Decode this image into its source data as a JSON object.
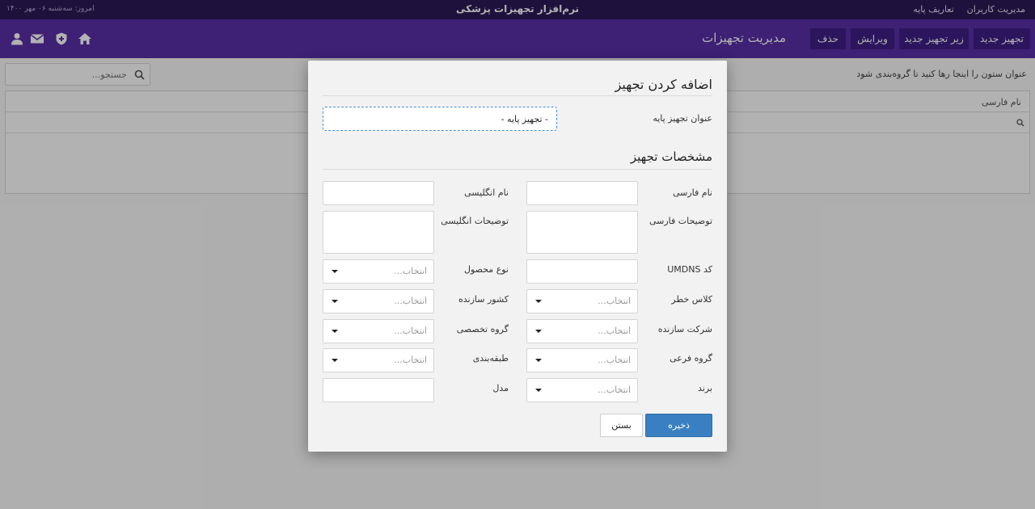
{
  "topbar": {
    "menu": [
      "مدیریت کاربران",
      "تعاریف پایه"
    ],
    "app_title": "نرم‌افزار تجهیزات پزشکی",
    "today": "امروز: سه‌شنبه ۰۶ مهر ۱۴۰۰"
  },
  "header": {
    "buttons": [
      "تجهیز جدید",
      "زیر تجهیز جدید",
      "ویرایش",
      "حذف"
    ],
    "page_title": "مدیریت تجهیزات",
    "icons": [
      "home-icon",
      "shield-icon",
      "mail-icon",
      "user-icon"
    ],
    "accent_color": "#5a2ea6",
    "top_color": "#2c1b58"
  },
  "grid": {
    "search_placeholder": "جستجو...",
    "group_hint": "عنوان ستون را اینجا رها کنید تا گروه‌بندی شود",
    "column": "نام فارسی"
  },
  "modal": {
    "title": "اضافه کردن تجهیز",
    "base_label": "عنوان تجهیز پایه",
    "base_value": "- تجهیز پایه -",
    "section_title": "مشخصات تجهیز",
    "select_placeholder": "انتخاب...",
    "fields": {
      "persian_name": "نام فارسی",
      "english_name": "نام انگلیسی",
      "persian_desc": "توضیحات فارسی",
      "english_desc": "توضیحات انگلیسی",
      "umdns": "کد UMDNS",
      "product_type": "نوع محصول",
      "risk_class": "کلاس خطر",
      "maker_country": "کشور سازنده",
      "maker_company": "شرکت سازنده",
      "specialty_group": "گروه تخصصی",
      "subgroup": "گروه فرعی",
      "classification": "طبقه‌بندی",
      "brand": "برند",
      "model": "مدل"
    },
    "save_label": "ذخیره",
    "close_label": "بستن",
    "save_color": "#3a7fc1"
  }
}
